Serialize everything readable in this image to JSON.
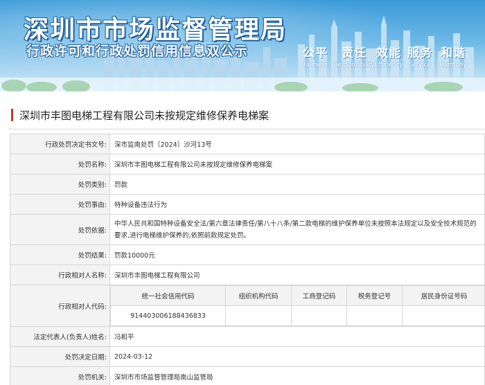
{
  "banner": {
    "title": "深圳市市场监督管理局",
    "subtitle": "行政许可和行政处罚信用信息双公示",
    "slogans": [
      {
        "cn": "公平",
        "en": "Fairness"
      },
      {
        "cn": "责任",
        "en": "Responsibility"
      },
      {
        "cn": "效能",
        "en": "Efficiency"
      },
      {
        "cn": "服务",
        "en": "Service"
      },
      {
        "cn": "和谐",
        "en": "Harmony"
      }
    ]
  },
  "case": {
    "title": "深圳市丰图电梯工程有限公司未按规定维修保养电梯案"
  },
  "details": {
    "doc_no": {
      "label": "行政处罚决定书文号:",
      "value": "深市监南处罚〔2024〕沙河13号"
    },
    "name": {
      "label": "处罚名称:",
      "value": "深圳市丰图电梯工程有限公司未按规定维修保养电梯案"
    },
    "category": {
      "label": "处罚类别:",
      "value": "罚款"
    },
    "reason": {
      "label": "处罚事由:",
      "value": "特种设备违法行为"
    },
    "basis": {
      "label": "处罚依据:",
      "value": "中华人民共和国特种设备安全法/第六章法律责任/第八十八条/第二款电梯的维护保养单位未按照本法规定以及安全技术规范的要求,进行电梯维护保养的,依照前款规定处罚。"
    },
    "result": {
      "label": "处罚结果:",
      "value": "罚款10000元"
    },
    "party_name": {
      "label": "行政相对人名称:",
      "value": "深圳市丰图电梯工程有限公司"
    },
    "party_code": {
      "label": "行政相对人代码:",
      "headers": [
        "统一社会信用代码",
        "组织机构代码",
        "工商登记码",
        "税务登记号",
        "居民身份证号码"
      ],
      "values": [
        "914403006188436833",
        "",
        "",
        "",
        ""
      ]
    },
    "legal_rep": {
      "label": "法定代表人(负责人)姓名:",
      "value": "冯和平"
    },
    "date": {
      "label": "处罚决定日期:",
      "value": "2024-03-12"
    },
    "authority": {
      "label": "处罚机关:",
      "value": "深圳市市场监督管理局南山监管局"
    }
  }
}
